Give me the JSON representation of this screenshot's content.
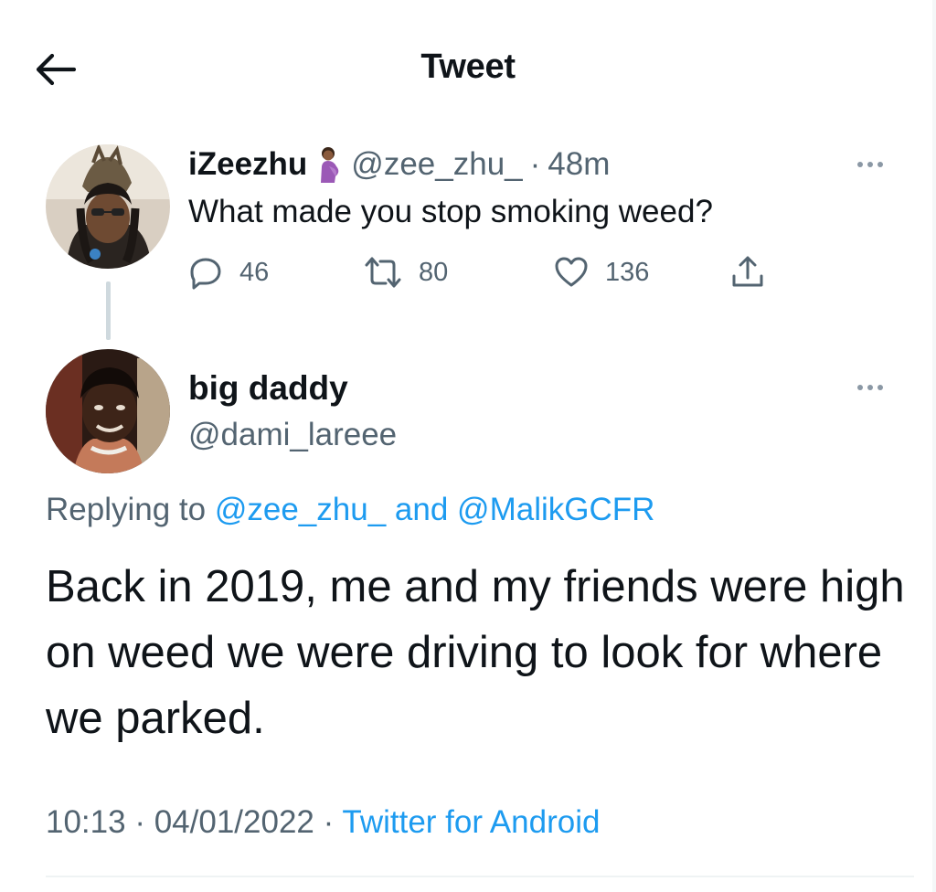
{
  "header": {
    "title": "Tweet"
  },
  "parent_tweet": {
    "display_name": "iZeezhu",
    "handle": "@zee_zhu_",
    "separator": "·",
    "time": "48m",
    "text": "What made you stop smoking weed?",
    "stats": {
      "replies": "46",
      "retweets": "80",
      "likes": "136"
    }
  },
  "reply_tweet": {
    "display_name": "big daddy",
    "handle": "@dami_lareee",
    "replying_prefix": "Replying to",
    "replying_mention_1": "@zee_zhu_",
    "replying_and": "and",
    "replying_mention_2": "@MalikGCFR",
    "text": "Back in 2019, me and my friends were high on weed we were driving to look for where we parked.",
    "time": "10:13",
    "sep_1": "·",
    "date": "04/01/2022",
    "sep_2": "·",
    "source": "Twitter for Android"
  },
  "colors": {
    "accent": "#1d9bf0",
    "secondary_text": "#536471",
    "primary_text": "#0f1419"
  },
  "icons": [
    "back-arrow-icon",
    "reply-icon",
    "retweet-icon",
    "like-icon",
    "share-icon",
    "more-icon"
  ]
}
